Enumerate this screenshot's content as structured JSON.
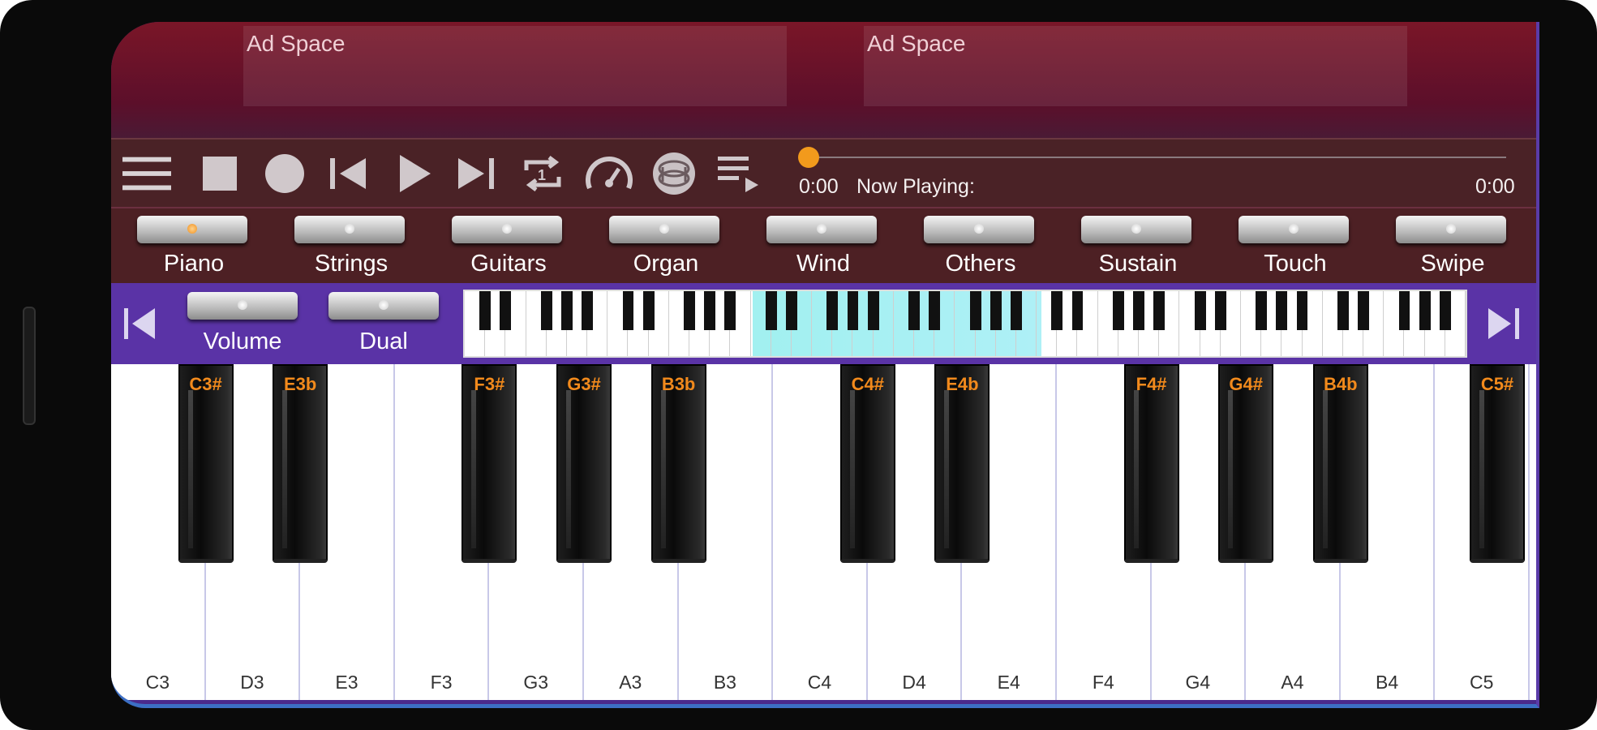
{
  "ads": [
    "Ad Space",
    "Ad Space"
  ],
  "toolbar": {
    "icons": [
      "menu-icon",
      "stop-icon",
      "record-icon",
      "skip-back-icon",
      "play-icon",
      "skip-forward-icon",
      "loop-icon",
      "tempo-icon",
      "drum-icon",
      "playlist-icon"
    ],
    "time_current": "0:00",
    "now_playing": "Now Playing:",
    "time_total": "0:00",
    "progress": 0
  },
  "instruments": [
    "Piano",
    "Strings",
    "Guitars",
    "Organ",
    "Wind",
    "Others",
    "Sustain",
    "Touch",
    "Swipe"
  ],
  "active_instrument": "Piano",
  "controls": {
    "volume_label": "Volume",
    "dual_label": "Dual"
  },
  "white_keys": [
    "C3",
    "D3",
    "E3",
    "F3",
    "G3",
    "A3",
    "B3",
    "C4",
    "D4",
    "E4",
    "F4",
    "G4",
    "A4",
    "B4",
    "C5"
  ],
  "black_keys": [
    "C3#",
    "E3b",
    "F3#",
    "G3#",
    "B3b",
    "C4#",
    "E4b",
    "F4#",
    "G4#",
    "B4b",
    "C5#"
  ],
  "colors": {
    "accent": "#f29a1c",
    "panel_purple": "#5a33a6",
    "panel_maroon": "#4d2024"
  }
}
